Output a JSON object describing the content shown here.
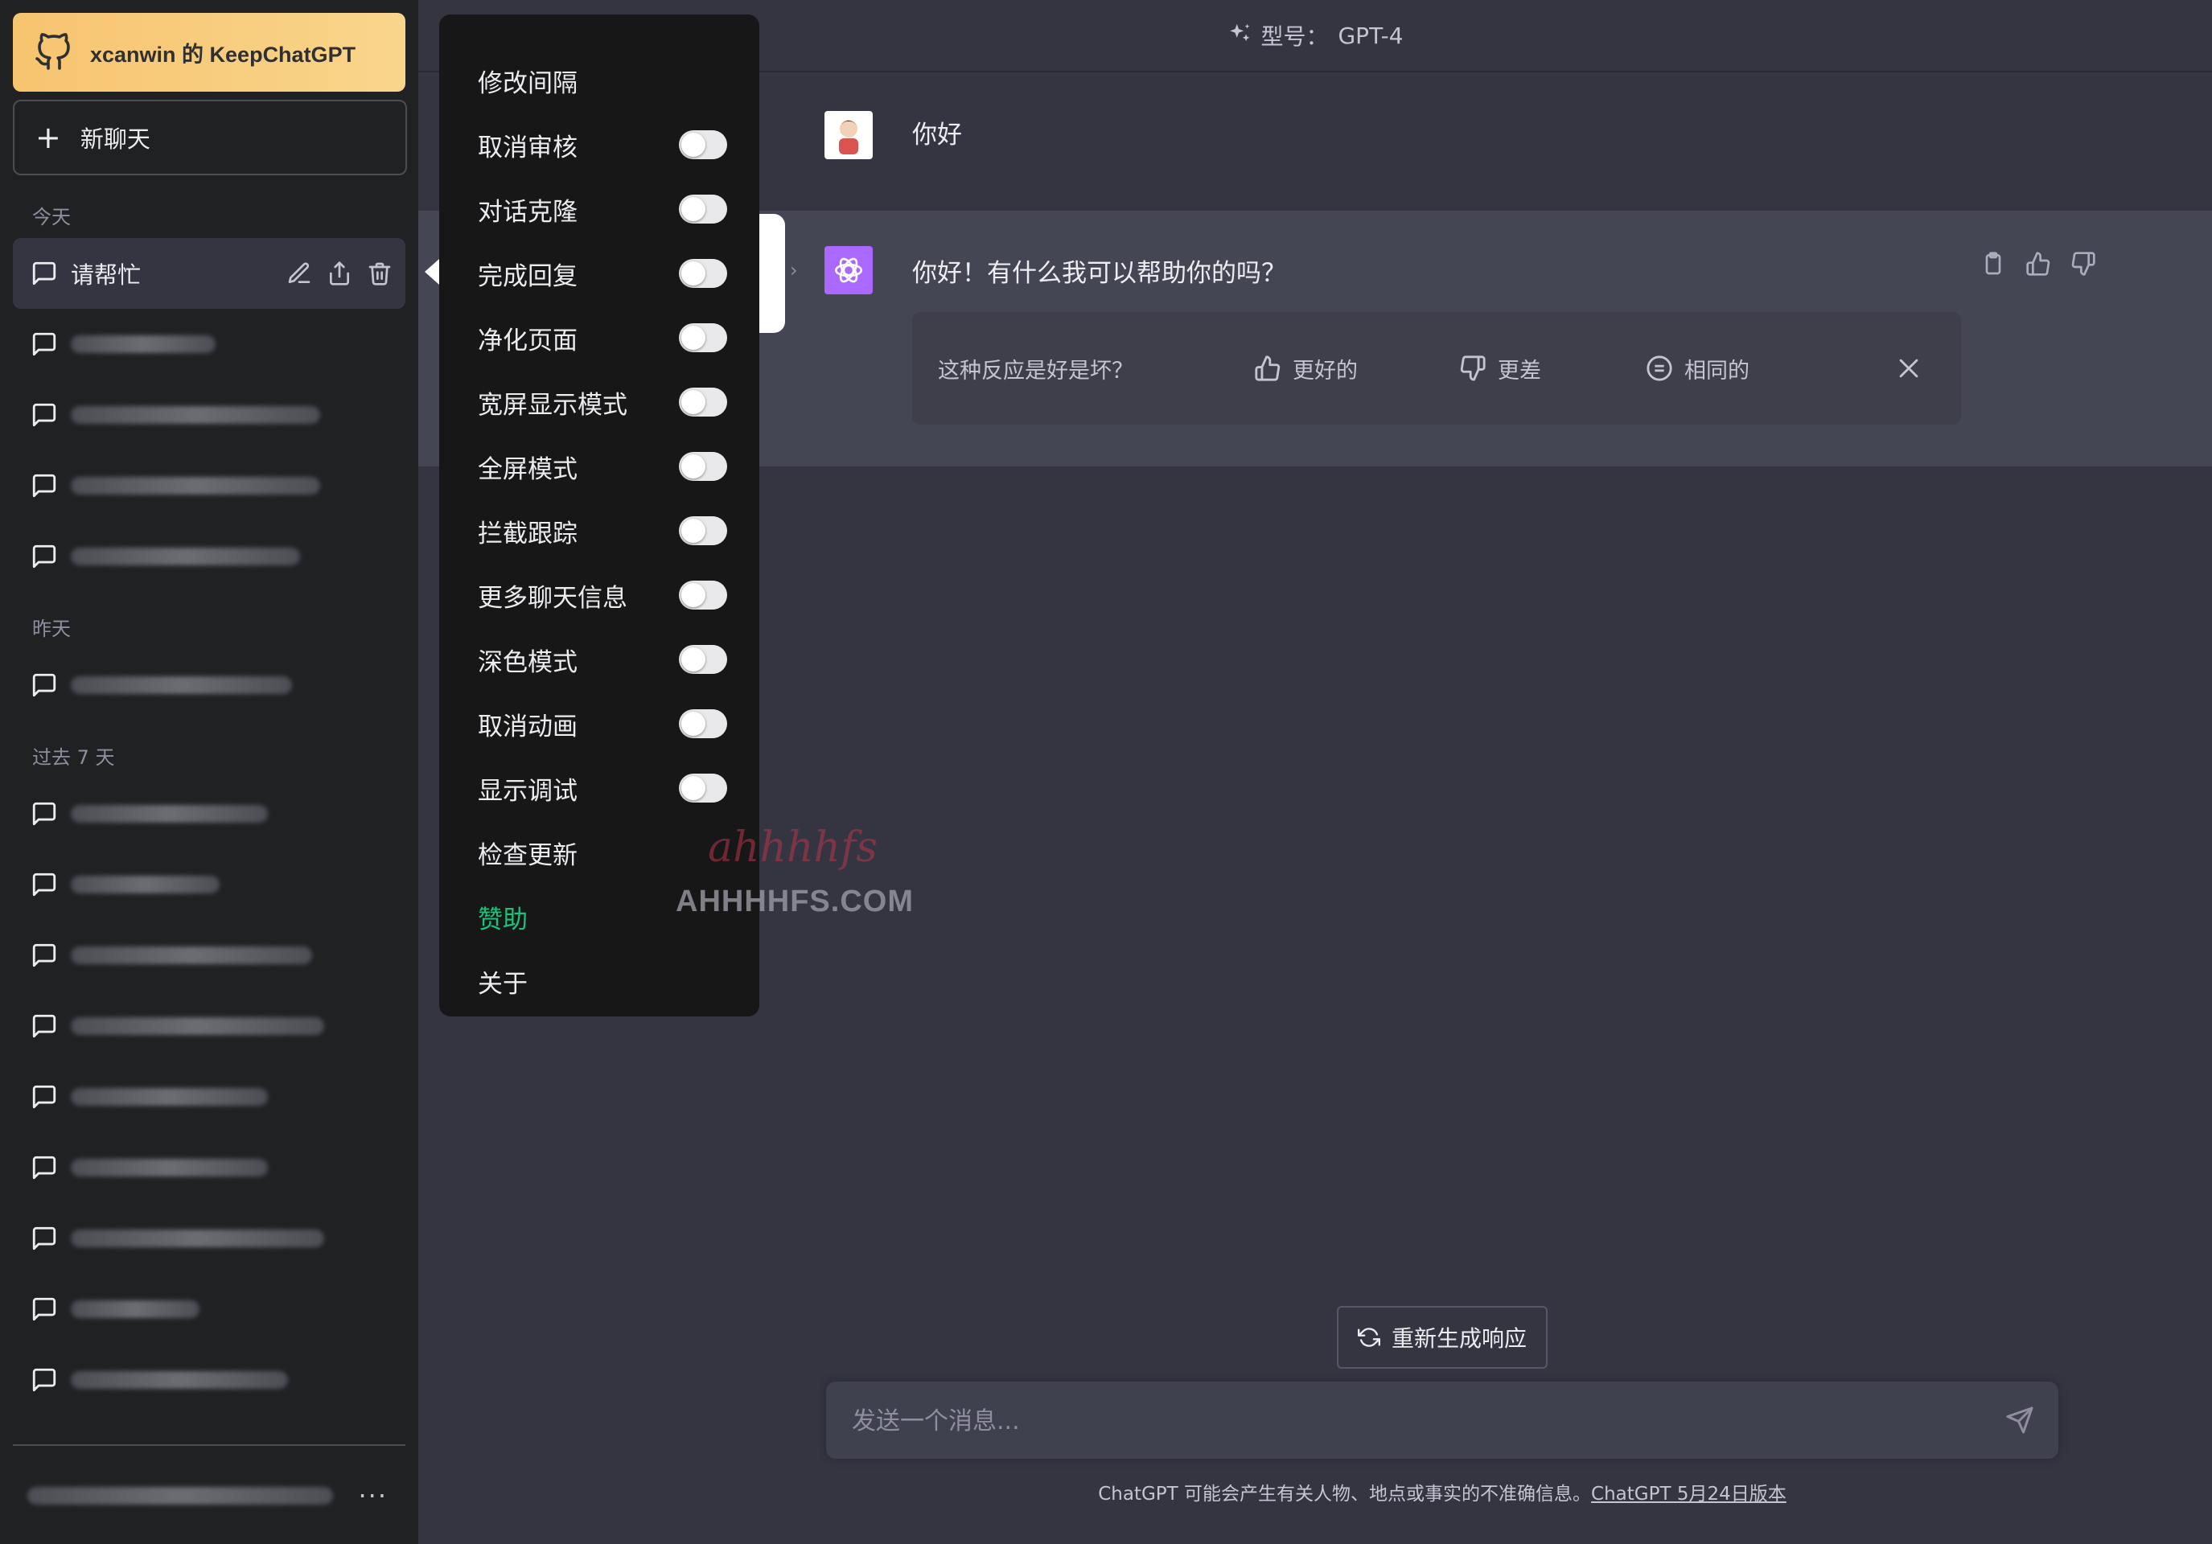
{
  "sidebar": {
    "brand": "xcanwin 的 KeepChatGPT",
    "new_chat": "新聊天",
    "groups": {
      "today": "今天",
      "yesterday": "昨天",
      "last7": "过去 7 天"
    },
    "active_chat": "请帮忙"
  },
  "header": {
    "model_label": "型号：",
    "model_name": "GPT-4"
  },
  "conversation": {
    "user_message": "你好",
    "assistant_message": "你好！有什么我可以帮助你的吗？",
    "feedback": {
      "question": "这种反应是好是坏？",
      "better": "更好的",
      "worse": "更差",
      "same": "相同的"
    }
  },
  "menu": {
    "interval": "修改间隔",
    "toggles": [
      "取消审核",
      "对话克隆",
      "完成回复",
      "净化页面",
      "宽屏显示模式",
      "全屏模式",
      "拦截跟踪",
      "更多聊天信息",
      "深色模式",
      "取消动画",
      "显示调试"
    ],
    "check_update": "检查更新",
    "sponsor": "赞助",
    "about": "关于",
    "sponsor_color": "#19c37d"
  },
  "bottom": {
    "regenerate": "重新生成响应",
    "input_placeholder": "发送一个消息...",
    "disclaimer": "ChatGPT 可能会产生有关人物、地点或事实的不准确信息。",
    "version_link": "ChatGPT 5月24日版本"
  },
  "watermark": {
    "top": "ahhhhfs",
    "bottom": "AHHHHFS.COM"
  },
  "colors": {
    "sidebar_bg": "#202123",
    "main_bg": "#343541",
    "assistant_bg": "#444654",
    "gpt_avatar": "#ab68ff"
  }
}
